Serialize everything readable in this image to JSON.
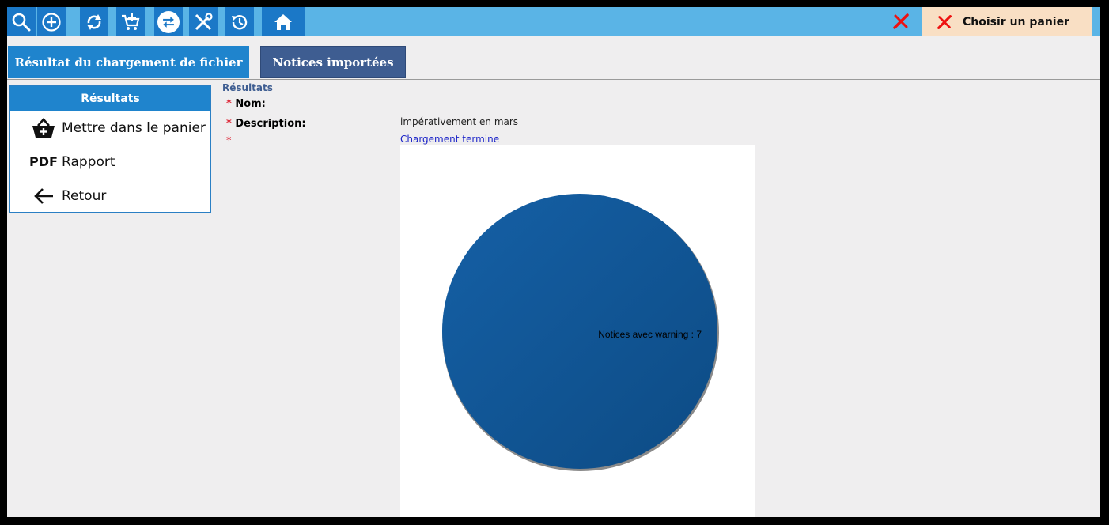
{
  "toolbar": {
    "buttons": [
      {
        "icon": "search-icon"
      },
      {
        "icon": "add-circle-icon"
      },
      {
        "icon": "refresh-icon"
      },
      {
        "icon": "cart-add-icon"
      },
      {
        "icon": "swap-arrows-icon"
      },
      {
        "icon": "tools-icon"
      },
      {
        "icon": "history-icon"
      },
      {
        "icon": "home-icon"
      }
    ],
    "basket_label": "Choisir un panier"
  },
  "tabs": [
    {
      "label": "Résultat du chargement de fichier"
    },
    {
      "label": "Notices importées"
    }
  ],
  "sidebar": {
    "title": "Résultats",
    "items": [
      {
        "label": "Mettre dans le panier",
        "icon": "basket-add-icon"
      },
      {
        "label": "Rapport",
        "icon_text": "PDF"
      },
      {
        "label": "Retour",
        "icon": "arrow-left-icon"
      }
    ]
  },
  "main": {
    "section_title": "Résultats",
    "fields": [
      {
        "label": "Nom:",
        "value": ""
      },
      {
        "label": "Description:",
        "value": "impérativement en mars"
      },
      {
        "label": "",
        "value": "Chargement termine"
      }
    ]
  },
  "chart_data": {
    "type": "pie",
    "slices": [
      {
        "label": "Notices avec warning",
        "value": 7,
        "color": "#11589a"
      }
    ],
    "data_label": "Notices avec warning : 7"
  },
  "colors": {
    "toolbar_bg": "#5ab4e6",
    "button_bg": "#1b78c7",
    "tab_active": "#1f84cd",
    "tab_inactive": "#3e5d91",
    "status_text": "#1a22c8",
    "required_star": "#dd2233",
    "section_title": "#3e5d91"
  }
}
